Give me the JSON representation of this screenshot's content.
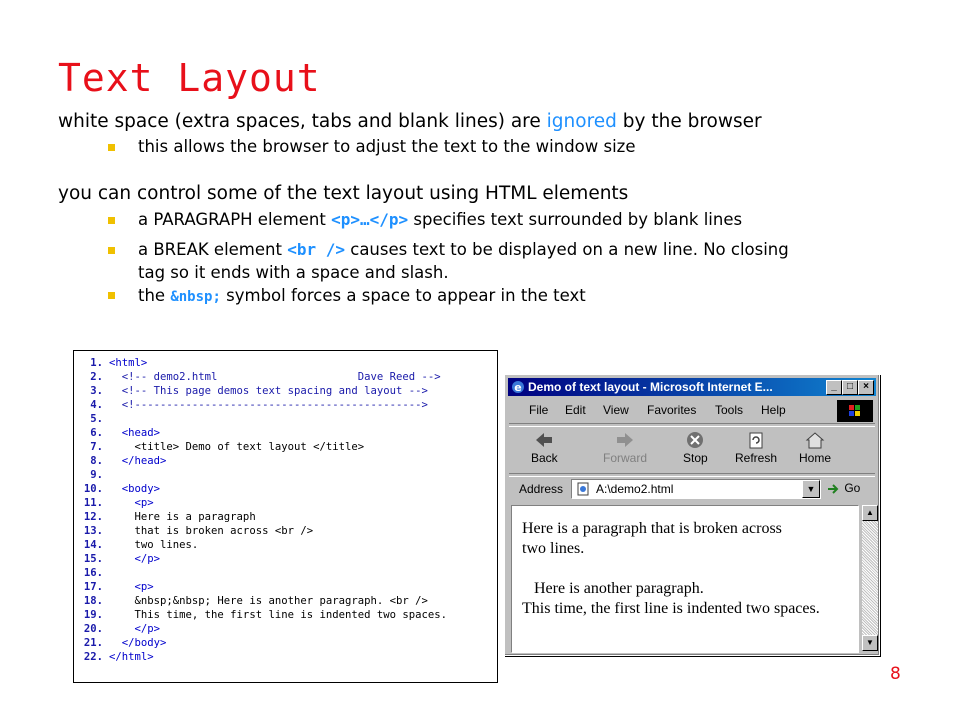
{
  "slide": {
    "title": "Text Layout",
    "page_number": "8",
    "line1_a": "white space (extra spaces, tabs and blank lines) are ",
    "line1_b": "ignored",
    "line1_c": " by the browser",
    "bullet1": "this allows the browser to adjust the text to the window size",
    "line2": "you can control some of the text layout using HTML elements",
    "bullet2_a": "a PARAGRAPH element ",
    "bullet2_code": "<p>…</p>",
    "bullet2_b": " specifies text surrounded by blank lines",
    "bullet3_a": "a BREAK element ",
    "bullet3_code": "<br />",
    "bullet3_b": " causes text to be displayed on a new line. No closing",
    "bullet3_c": "tag so it ends with a space and slash.",
    "bullet4_a": "the ",
    "bullet4_code": "&nbsp;",
    "bullet4_b": " symbol forces a space to appear in the text",
    "bullet_color": "#f0c000",
    "accent_color": "#e8101a"
  },
  "code": {
    "n1": "1.",
    "t1": "<html>",
    "n2": "2.",
    "t2": "  <!-- demo2.html                      Dave Reed -->",
    "n3": "3.",
    "t3": "  <!-- This page demos text spacing and layout -->",
    "n4": "4.",
    "t4": "  <!--------------------------------------------->",
    "n5": "5.",
    "t5": "",
    "n6": "6.",
    "t6": "  <head>",
    "n7": "7.",
    "t7": "    <title> Demo of text layout </title>",
    "n8": "8.",
    "t8": "  </head>",
    "n9": "9.",
    "t9": "",
    "n10": "10.",
    "t10": "  <body>",
    "n11": "11.",
    "t11": "    <p>",
    "n12": "12.",
    "t12": "    Here is a paragraph",
    "n13": "13.",
    "t13": "    that is broken across <br />",
    "n14": "14.",
    "t14": "    two lines.",
    "n15": "15.",
    "t15": "    </p>",
    "n16": "16.",
    "t16": "",
    "n17": "17.",
    "t17": "    <p>",
    "n18": "18.",
    "t18": "    &nbsp;&nbsp; Here is another paragraph. <br />",
    "n19": "19.",
    "t19": "    This time, the first line is indented two spaces.",
    "n20": "20.",
    "t20": "    </p>",
    "n21": "21.",
    "t21": "  </body>",
    "n22": "22.",
    "t22": "</html>"
  },
  "browser": {
    "title": "Demo of text layout - Microsoft Internet E...",
    "menu": {
      "file": "File",
      "edit": "Edit",
      "view": "View",
      "favorites": "Favorites",
      "tools": "Tools",
      "help": "Help"
    },
    "toolbar": {
      "back": "Back",
      "forward": "Forward",
      "stop": "Stop",
      "refresh": "Refresh",
      "home": "Home"
    },
    "address_label": "Address",
    "address_value": "A:\\demo2.html",
    "go_label": "Go",
    "content": {
      "p1_line1": "Here is a paragraph that is broken across",
      "p1_line2": "two lines.",
      "p2_line1": "   Here is another paragraph.",
      "p2_line2": "This time, the first line is indented two spaces."
    }
  }
}
